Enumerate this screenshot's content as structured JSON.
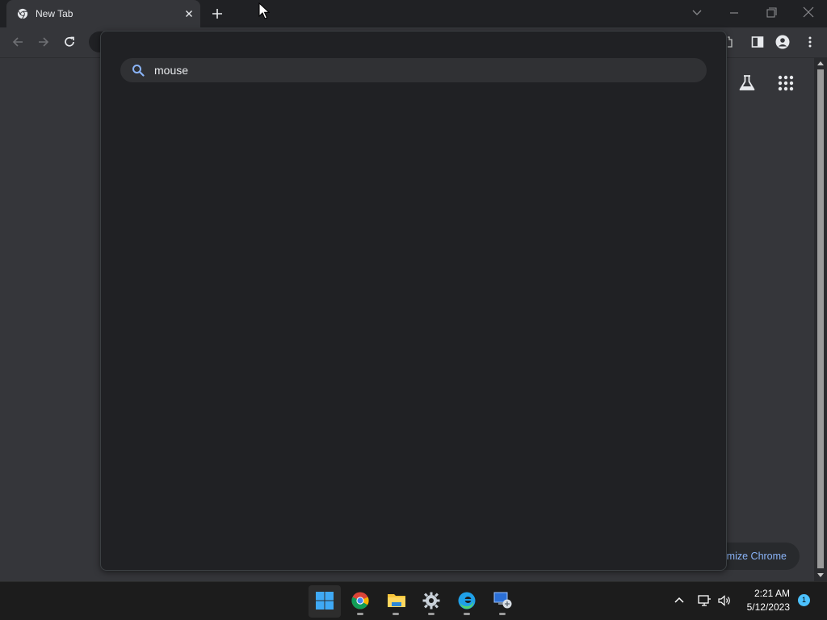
{
  "browser": {
    "tab_title": "New Tab"
  },
  "search": {
    "value": "mouse",
    "placeholder": ""
  },
  "ntp": {
    "customize_label": "mize Chrome"
  },
  "taskbar": {
    "apps": [
      "start-icon",
      "chrome-icon",
      "file-explorer-icon",
      "settings-icon",
      "edge-icon",
      "remote-desktop-icon"
    ],
    "clock_time": "2:21 AM",
    "clock_date": "5/12/2023",
    "notification_count": "1"
  },
  "colors": {
    "accent": "#8ab4f8",
    "page_bg": "#35363a",
    "popup_bg": "#202124",
    "badge": "#4cc2ff"
  }
}
